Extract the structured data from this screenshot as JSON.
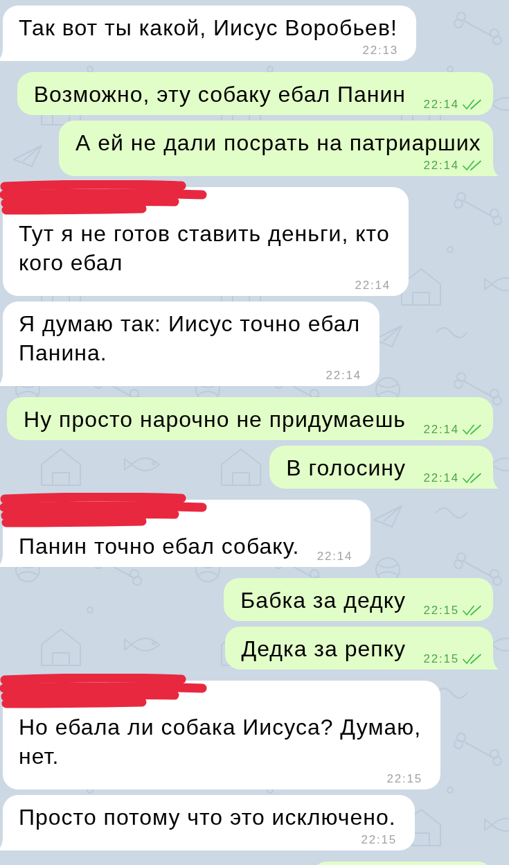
{
  "messages": [
    {
      "outgoing": false,
      "text": "Так вот ты какой, Иисус Воробьев!",
      "time": "22:13",
      "sender_redacted": false,
      "tail": true
    },
    {
      "outgoing": true,
      "text": "Возможно, эту собаку ебал Панин",
      "time": "22:14",
      "read": true,
      "tail": false
    },
    {
      "outgoing": true,
      "text": "А ей не дали посрать на патриарших",
      "time": "22:14",
      "read": true,
      "tail": true
    },
    {
      "outgoing": false,
      "text": "Тут я не готов ставить деньги, кто кого ебал",
      "time": "22:14",
      "sender_redacted": true,
      "tail": false
    },
    {
      "outgoing": false,
      "text": "Я думаю так: Иисус точно ебал Панина.",
      "time": "22:14",
      "sender_redacted": false,
      "tail": true
    },
    {
      "outgoing": true,
      "text": "Ну просто нарочно не придумаешь",
      "time": "22:14",
      "read": true,
      "tail": false
    },
    {
      "outgoing": true,
      "text": "В голосину",
      "time": "22:14",
      "read": true,
      "tail": true
    },
    {
      "outgoing": false,
      "text": "Панин точно ебал собаку.",
      "time": "22:14",
      "sender_redacted": true,
      "tail": true
    },
    {
      "outgoing": true,
      "text": "Бабка за дедку",
      "time": "22:15",
      "read": true,
      "tail": false
    },
    {
      "outgoing": true,
      "text": "Дедка за репку",
      "time": "22:15",
      "read": true,
      "tail": true
    },
    {
      "outgoing": false,
      "text": "Но ебала ли собака Иисуса? Думаю, нет.",
      "time": "22:15",
      "sender_redacted": true,
      "tail": false
    },
    {
      "outgoing": false,
      "text": "Просто потому что это исключено.",
      "time": "22:15",
      "sender_redacted": false,
      "tail": true
    },
    {
      "outgoing": true
    }
  ]
}
